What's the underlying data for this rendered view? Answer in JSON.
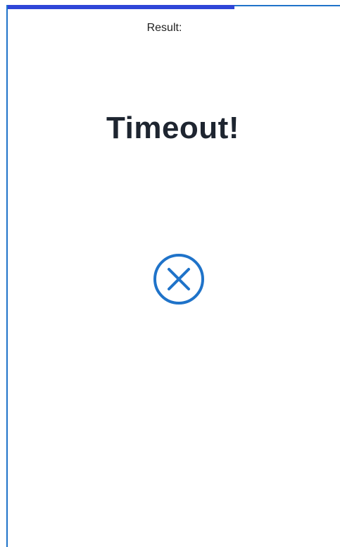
{
  "result_screen": {
    "label": "Result:",
    "title": "Timeout!",
    "status_icon": "close-circle-icon",
    "progress_fraction": 0.67
  },
  "colors": {
    "frame_border": "#1f73c9",
    "progress": "#2f46d8",
    "icon": "#1f73c9",
    "title": "#1e2530"
  }
}
